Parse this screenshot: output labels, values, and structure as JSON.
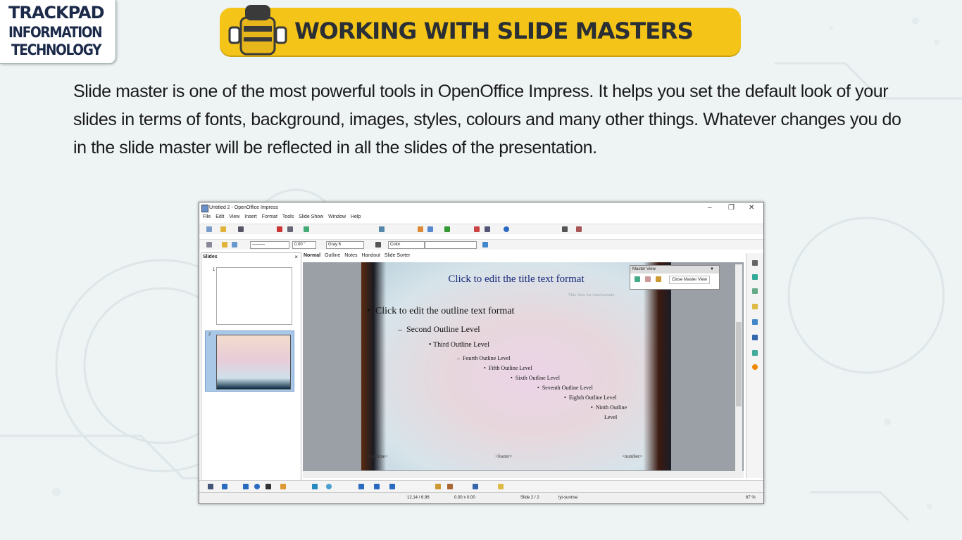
{
  "logo": {
    "line1": "TRACKPAD",
    "line2": "INFORMATION",
    "line3": "TECHNOLOGY"
  },
  "banner": {
    "title": "WORKING WITH SLIDE MASTERS",
    "color": "#f4c518"
  },
  "intro": {
    "text": "Slide master is one of the most powerful tools in OpenOffice Impress. It helps you set the default look of your slides in terms of fonts, background, images, styles, colours and many other things. Whatever changes you do in the slide master will be reflected in all the slides of the presentation."
  },
  "window": {
    "title": "Untitled 2 - OpenOffice Impress",
    "menu": [
      "File",
      "Edit",
      "View",
      "Insert",
      "Format",
      "Tools",
      "Slide Show",
      "Window",
      "Help"
    ],
    "toolbar2": {
      "line_width": "0.00 \"",
      "area_color": "Gray 6",
      "area_style": "Color"
    },
    "slides_pane": {
      "header": "Slides",
      "close": "×",
      "numbers": [
        "1",
        "2"
      ]
    },
    "tabs": [
      "Normal",
      "Outline",
      "Notes",
      "Handout",
      "Slide Sorter"
    ],
    "slide": {
      "title": "Click to edit the title text format",
      "title_area_label": "Title Area for AutoLayouts",
      "levels": [
        "Click to edit the outline text format",
        "Second Outline Level",
        "Third Outline Level",
        "Fourth Outline Level",
        "Fifth Outline Level",
        "Sixth Outline Level",
        "Seventh Outline Level",
        "Eighth Outline Level",
        "Ninth Outline",
        "Level"
      ],
      "footer": {
        "date": "<date/time>",
        "footer": "<footer>",
        "number": "<number>"
      }
    },
    "master_view": {
      "title": "Master View",
      "close_label": "Close Master View"
    },
    "status": {
      "position": "12.14 / 6.96",
      "size": "0.00 x 0.00",
      "slide": "Slide 2 / 2",
      "layout": "lyt-sunrise",
      "zoom": "67 %"
    }
  }
}
